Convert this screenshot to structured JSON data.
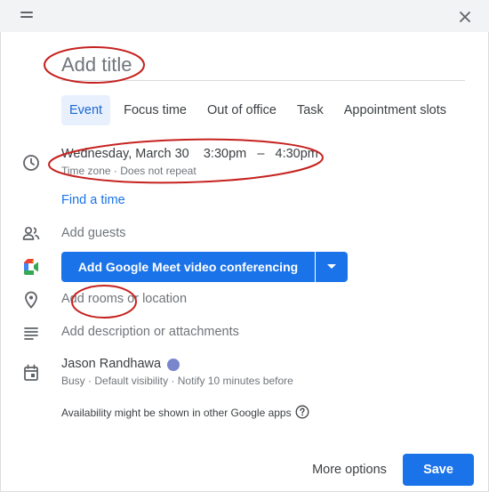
{
  "title_field": {
    "placeholder": "Add title"
  },
  "tabs": [
    {
      "label": "Event",
      "active": true
    },
    {
      "label": "Focus time",
      "active": false
    },
    {
      "label": "Out of office",
      "active": false
    },
    {
      "label": "Task",
      "active": false
    },
    {
      "label": "Appointment slots",
      "active": false
    }
  ],
  "datetime": {
    "date": "Wednesday, March 30",
    "start": "3:30pm",
    "separator": "–",
    "end": "4:30pm",
    "time_zone": "Time zone",
    "sub_separator": "·",
    "repeat": "Does not repeat"
  },
  "find_time": "Find a time",
  "guests": {
    "label": "Add guests",
    "icon": "people-icon"
  },
  "meet": {
    "label": "Add Google Meet video conferencing",
    "icon": "google-meet-icon"
  },
  "location": {
    "label": "Add rooms or location",
    "icon": "location-pin-icon"
  },
  "description": {
    "label": "Add description or attachments",
    "icon": "notes-icon"
  },
  "calendar": {
    "owner": "Jason Randhawa",
    "color": "#7986cb",
    "busy": "Busy",
    "visibility": "Default visibility",
    "notify": "Notify 10 minutes before",
    "sep": "·"
  },
  "availability_note": "Availability might be shown in other Google apps",
  "footer": {
    "more_options": "More options",
    "save": "Save"
  },
  "colors": {
    "accent": "#1a73e8",
    "annotation": "#c5221f",
    "tab_active_bg": "#e8f0fe"
  }
}
